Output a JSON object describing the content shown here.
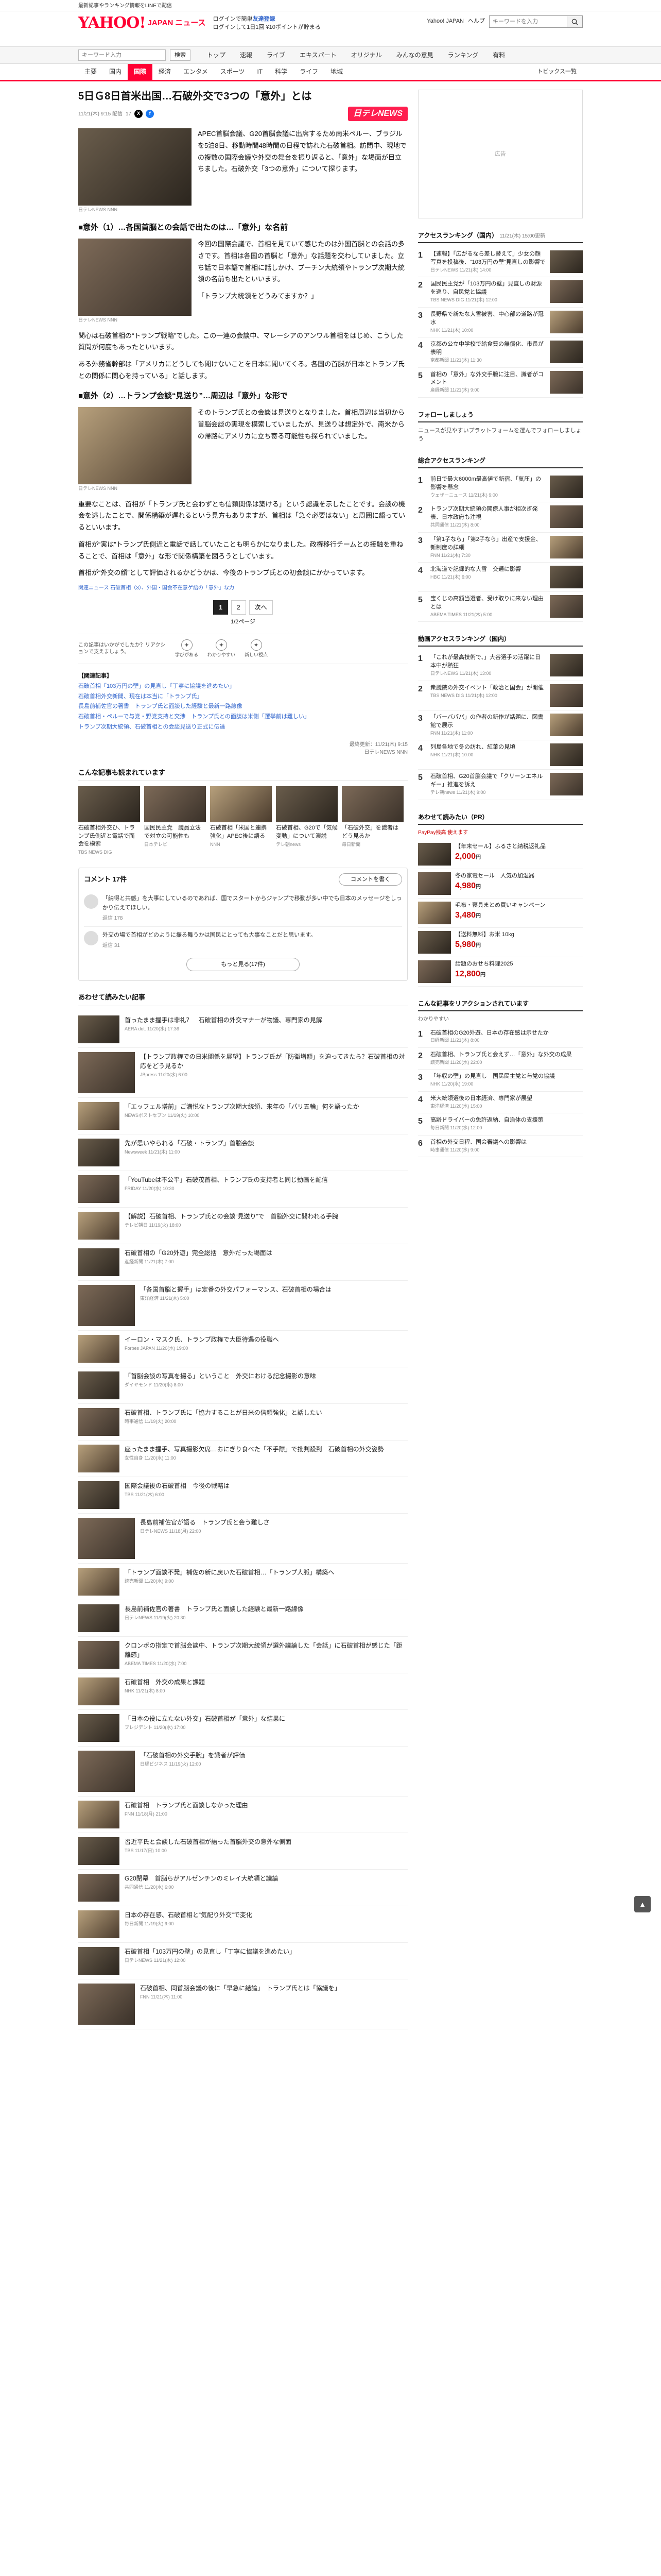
{
  "topbar": {
    "notice": "最新記事やランキング情報をLINEで配信"
  },
  "header": {
    "logo": "YAHOO!",
    "logo_sub": "JAPAN",
    "section": "ニュース",
    "notice_line1": "ログインで簡単",
    "notice_line1_accent": "友達登録",
    "notice_line2": "ログインして1日1回 ¥10ポイントが貯まる",
    "links": [
      "Yahoo! JAPAN",
      "ヘルプ"
    ],
    "search_placeholder": "キーワードを入力"
  },
  "mainnav": {
    "keyword_placeholder": "キーワード入力",
    "search_label": "検索",
    "categories": [
      "トップ",
      "速報",
      "ライブ",
      "エキスパート",
      "オリジナル",
      "みんなの意見",
      "ランキング",
      "有料"
    ]
  },
  "subnav": {
    "items": [
      "主要",
      "国内",
      "国際",
      "経済",
      "エンタメ",
      "スポーツ",
      "IT",
      "科学",
      "ライフ",
      "地域"
    ],
    "active": 2,
    "topics": "トピックス一覧"
  },
  "article": {
    "title": "5日Ｇ8日首米出国…石破外交で3つの「意外」とは",
    "date": "11/21(木) 9:15 配信",
    "comments_count": "17",
    "brand": "日テレNEWS",
    "lead": "APEC首脳会議、G20首脳会議に出席するため南米ペルー、ブラジルを5泊8日、移動時間48時間の日程で訪れた石破首相。訪問中、現地での複数の国際会議や外交の舞台を振り返ると、「意外」な場面が目立ちました。石破外交「3つの意外」について探ります。",
    "caption": "日テレNEWS NNN",
    "s1_head": "■意外（1）…各国首脳との会話で出たのは…「意外」な名前",
    "s1_p1": "今回の国際会議で、首相を見ていて感じたのは外国首脳との会話の多さです。首相は各国の首脳と「意外」な話題を交わしていました。立ち話で日本語で首相に話しかけ、プーチン大統領やトランプ次期大統領の名前も出たといいます。",
    "s1_p2": "「トランプ大統領をどうみてますか？」",
    "s1_p3": "関心は石破首相の“トランプ戦略”でした。この一連の会談中、マレーシアのアンワル首相をはじめ、こうした質問が何度もあったといいます。",
    "s1_p4": "ある外務省幹部は「アメリカにどうしても聞けないことを日本に聞いてくる。各国の首脳が日本とトランプ氏との関係に関心を持っている」と話します。",
    "s2_head": "■意外（2）…トランプ会談“見送り”…周辺は「意外」な形で",
    "s2_p1": "そのトランプ氏との会談は見送りとなりました。首相周辺は当初から首脳会談の実現を模索していましたが、見送りは想定外で、南米からの帰路にアメリカに立ち寄る可能性も探られていました。",
    "s2_p2": "重要なことは、首相が「トランプ氏と会わずとも信頼関係は築ける」という認識を示したことです。会談の機会を逃したことで、関係構築が遅れるという見方もありますが、首相は「急ぐ必要はない」と周囲に語っているといいます。",
    "s2_p3": "首相が“実は”トランプ氏側近と電話で話していたことも明らかになりました。政権移行チームとの接触を重ねることで、首相は「意外」な形で関係構築を図ろうとしています。",
    "s2_p4": "首相が“外交の顔”として評価されるかどうかは、今後のトランプ氏との初会談にかかっています。",
    "related": "関連ニュース  石破首相（3）、外国・国会不在意ゲ語の「意外」な力",
    "pages": [
      "1",
      "2",
      "次へ"
    ],
    "current_page": "1",
    "page_count": "1/2ページ",
    "reaction_note": "この記事はいかがでしたか？リアクションで支えましょう。",
    "reactions": [
      "学びがある",
      "わかりやすい",
      "新しい視点"
    ],
    "rel_head": "【関連記事】",
    "rel_links": [
      "石破首相「103万円の壁」の見直し「丁寧に協議を進めたい」",
      "石破首相外交新聞、現在は本当に「トランプ氏」",
      "長島前補佐官の著書　トランプ氏と面談した経験と最新一路線像",
      "石破首相・ペルーで与党・野党支持と交渉　トランプ氏との面談は米側「選挙前は難しい」",
      "トランプ次期大統領、石破首相との会談見送り正式に伝達"
    ],
    "credit": "最終更新：11/21(木) 9:15",
    "credit_brand": "日テレNEWS NNN"
  },
  "recommend": {
    "title": "こんな記事も読まれています",
    "items": [
      {
        "title": "石破首相外交ひ、トランプ氏側近と電話で面会を模索",
        "source": "TBS NEWS DIG"
      },
      {
        "title": "国民民主党　議員立法で対立の可能性も",
        "source": "日本テレビ"
      },
      {
        "title": "石破首相「米国と連携強化」APEC後に語る",
        "source": "NNN"
      },
      {
        "title": "石破首相、G20で「気候変動」について演説",
        "source": "テレ朝news"
      },
      {
        "title": "「石破外交」を識者はどう見るか",
        "source": "毎日新聞"
      }
    ]
  },
  "comments": {
    "label": "コメント",
    "count": "17件",
    "write_btn": "コメントを書く",
    "items": [
      {
        "text": "「納得と共感」を大事にしているのであれば、国でスタートからジャンプで移動が多い中でも日本のメッセージをしっかり伝えてほしい。",
        "meta": "返信 178"
      },
      {
        "text": "外交の場で首相がどのように振る舞うかは国民にとっても大事なことだと思います。",
        "meta": "返信 31"
      }
    ],
    "more_btn": "もっと見る(17件)"
  },
  "feed": {
    "title": "あわせて読みたい記事",
    "items": [
      {
        "title": "首ったまま握手は非礼？　石破首相の外交マナーが物議、専門家の見解",
        "source": "AERA dot. 11/20(水) 17:36"
      },
      {
        "title": "【トランプ政権での日米関係を展望】トランプ氏が「防衛増額」を迫ってきたら？石破首相の対応をどう見るか",
        "source": "JBpress 11/20(水) 6:00"
      },
      {
        "title": "「エッフェル塔前」ご満悦なトランプ次期大統領、来年の「パリ五輪」何を語ったか",
        "source": "NEWSポストセブン 11/19(火) 10:00"
      },
      {
        "title": "先が思いやられる「石破・トランプ」首脳会談",
        "source": "Newsweek 11/21(木) 11:00"
      },
      {
        "title": "「YouTubeは不公平」石破茂首相、トランプ氏の支持者と同じ動画を配信",
        "source": "FRIDAY 11/20(水) 10:30"
      },
      {
        "title": "【解説】石破首相、トランプ氏との会談“見送り”で　首脳外交に問われる手腕",
        "source": "テレビ朝日 11/19(火) 18:00"
      },
      {
        "title": "石破首相の「G20外遊」完全総括　意外だった場面は",
        "source": "産経新聞 11/21(木) 7:00"
      },
      {
        "title": "「各国首脳と握手」は定番の外交パフォーマンス、石破首相の場合は",
        "source": "東洋経済 11/21(木) 5:00"
      },
      {
        "title": "イーロン・マスク氏、トランプ政権で大臣待遇の役職へ",
        "source": "Forbes JAPAN 11/20(水) 19:00"
      },
      {
        "title": "「首脳会談の写真を撮る」ということ　外交における記念撮影の意味",
        "source": "ダイヤモンド 11/20(水) 8:00"
      },
      {
        "title": "石破首相、トランプ氏に「協力することが日米の信頼強化」と話したい",
        "source": "時事通信 11/19(火) 20:00"
      },
      {
        "title": "座ったまま握手、写真撮影欠席…おにぎり食べた「不手際」で批判殺到　石破首相の外交姿勢",
        "source": "女性自身 11/20(水) 11:00"
      },
      {
        "title": "国際会議後の石破首相　今後の戦略は",
        "source": "TBS 11/21(木) 6:00"
      },
      {
        "title": "長島前補佐官が語る　トランプ氏と会う難しさ",
        "source": "日テレNEWS 11/18(月) 22:00"
      },
      {
        "title": "「トランプ面談不発」補佐の新に戻いた石破首相…「トランプ人脈」構築へ",
        "source": "読売新聞 11/20(水) 9:00"
      },
      {
        "title": "長島前補佐官の著書　トランプ氏と面談した経験と最新一路線像",
        "source": "日テレNEWS 11/19(火) 20:30"
      },
      {
        "title": "クロンボの指定で首脳会談中、トランプ次期大統領が選外議論した「会話」に石破首相が感じた「距離感」",
        "source": "ABEMA TIMES 11/20(水) 7:00"
      },
      {
        "title": "石破首相　外交の成果と課題",
        "source": "NHK 11/21(木) 8:00"
      },
      {
        "title": "「日本の役に立たない外交」石破首相が「意外」な結果に",
        "source": "プレジデント 11/20(水) 17:00"
      },
      {
        "title": "「石破首相の外交手腕」を識者が評価",
        "source": "日経ビジネス 11/19(火) 12:00"
      },
      {
        "title": "石破首相　トランプ氏と面談しなかった理由",
        "source": "FNN 11/18(月) 21:00"
      },
      {
        "title": "習近平氏と会談した石破首相が語った首脳外交の意外な側面",
        "source": "TBS 11/17(日) 10:00"
      },
      {
        "title": "G20閉幕　首脳らがアルゼンチンのミレイ大統領と議論",
        "source": "共同通信 11/20(水) 6:00"
      },
      {
        "title": "日本の存在感、石破首相と“気配り外交”で変化",
        "source": "毎日新聞 11/19(火) 9:00"
      },
      {
        "title": "石破首相「103万円の壁」の見直し「丁寧に協議を進めたい」",
        "source": "日テレNEWS 11/21(木) 12:00"
      },
      {
        "title": "石破首相、同首脳会議の後に「早急に結論」　トランプ氏とは「協議を」",
        "source": "FNN 11/21(木) 11:00"
      }
    ]
  },
  "sidebar": {
    "ad": "広告",
    "ranking_title": "アクセスランキング（国内）",
    "ranking_time": "11/21(木) 15:00更新",
    "ranking": [
      {
        "title": "【速報】「広がるなら差し替えて」少女の顔写真を投稿後、“103万円の壁”見直しの影響で",
        "source": "日テレNEWS 11/21(木) 14:00"
      },
      {
        "title": "国民民主党が「103万円の壁」見直しの財源を巡り、自民党と協議",
        "source": "TBS NEWS DIG 11/21(木) 12:00"
      },
      {
        "title": "長野県で新たな大雪被害、中心部の道路が冠水",
        "source": "NHK 11/21(木) 10:00"
      },
      {
        "title": "京都の公立中学校で給食費の無償化、市長が表明",
        "source": "京都新聞 11/21(木) 11:30"
      },
      {
        "title": "首相の「意外」な外交手腕に注目、識者がコメント",
        "source": "産経新聞 11/21(木) 9:00"
      }
    ],
    "follow_title": "フォローしましょう",
    "follow_text": "ニュースが見やすいプラットフォームを選んでフォローしましょう",
    "ranking2_title": "総合アクセスランキング",
    "ranking2": [
      {
        "title": "前日で最大6000m最高値で新宿、「気圧」の影響を懸念",
        "source": "ウェザーニュース 11/21(木) 9:00"
      },
      {
        "title": "トランプ次期大統領の閣僚人事が相次ぎ発表、日本政府も注視",
        "source": "共同通信 11/21(木) 8:00"
      },
      {
        "title": "「第1子なら」「第2子なら」出産で支援金、新制度の詳細",
        "source": "FNN 11/21(木) 7:30"
      },
      {
        "title": "北海道で記録的な大雪　交通に影響",
        "source": "HBC 11/21(木) 6:00"
      },
      {
        "title": "宝くじの高額当選者、受け取りに来ない理由とは",
        "source": "ABEMA TIMES 11/21(木) 5:00"
      }
    ],
    "ranking3_title": "動画アクセスランキング（国内）",
    "ranking3": [
      {
        "title": "「これが最高技術で、」大谷選手の活躍に日本中が熱狂",
        "source": "日テレNEWS 11/21(木) 13:00"
      },
      {
        "title": "衆議院の外交イベント「政治と国会」が開催",
        "source": "TBS NEWS DIG 11/21(木) 12:00"
      },
      {
        "title": "「バーバパパ」の作者の新作が話題に、図書館で展示",
        "source": "FNN 11/21(木) 11:00"
      },
      {
        "title": "列島各地で冬の訪れ、紅葉の見頃",
        "source": "NHK 11/21(木) 10:00"
      },
      {
        "title": "石破首相、G20首脳会議で「クリーンエネルギー」推進を訴え",
        "source": "テレ朝news 11/21(木) 9:00"
      }
    ],
    "shop_title": "あわせて読みたい（PR）",
    "paypay": "PayPay残高 使えます",
    "shop": [
      {
        "title": "【年末セール】ふるさと納税返礼品",
        "price": "2,000",
        "unit": "円"
      },
      {
        "title": "冬の家電セール　人気の加湿器",
        "price": "4,980",
        "unit": "円"
      },
      {
        "title": "毛布・寝具まとめ買いキャンペーン",
        "price": "3,480",
        "unit": "円"
      },
      {
        "title": "【送料無料】お米 10kg",
        "price": "5,980",
        "unit": "円"
      },
      {
        "title": "話題のおせち料理2025",
        "price": "12,800",
        "unit": "円"
      }
    ],
    "cheer_title": "こんな記事をリアクションされています",
    "cheer_tag": "わかりやすい",
    "cheer": [
      {
        "title": "石破首相のG20外遊、日本の存在感は示せたか",
        "source": "日経新聞 11/21(木) 8:00"
      },
      {
        "title": "石破首相、トランプ氏と会えず…「意外」な外交の成果",
        "source": "読売新聞 11/20(水) 22:00"
      },
      {
        "title": "「年収の壁」の見直し　国民民主党と与党の協議",
        "source": "NHK 11/20(水) 19:00"
      },
      {
        "title": "米大統領選後の日本経済、専門家が展望",
        "source": "東洋経済 11/20(水) 15:00"
      },
      {
        "title": "高齢ドライバーの免許返納、自治体の支援策",
        "source": "毎日新聞 11/20(水) 12:00"
      },
      {
        "title": "首相の外交日程、国会審議への影響は",
        "source": "時事通信 11/20(水) 9:00"
      }
    ]
  },
  "colors": {
    "brand": "#ff0033",
    "link": "#3366cc"
  },
  "icons": [
    "search-icon",
    "x-icon",
    "facebook-icon",
    "bulb-icon",
    "page-top-icon"
  ]
}
